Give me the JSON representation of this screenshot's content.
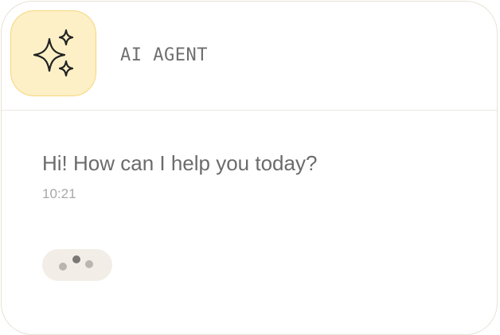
{
  "agent": {
    "name": "AI AGENT",
    "avatar_icon": "sparkles-icon",
    "avatar_bg": "#fdf0c7",
    "avatar_border": "#f5d77a"
  },
  "chat": {
    "message": "Hi! How can I help you today?",
    "timestamp": "10:21",
    "typing_indicator_icon": "typing-dots-icon"
  }
}
